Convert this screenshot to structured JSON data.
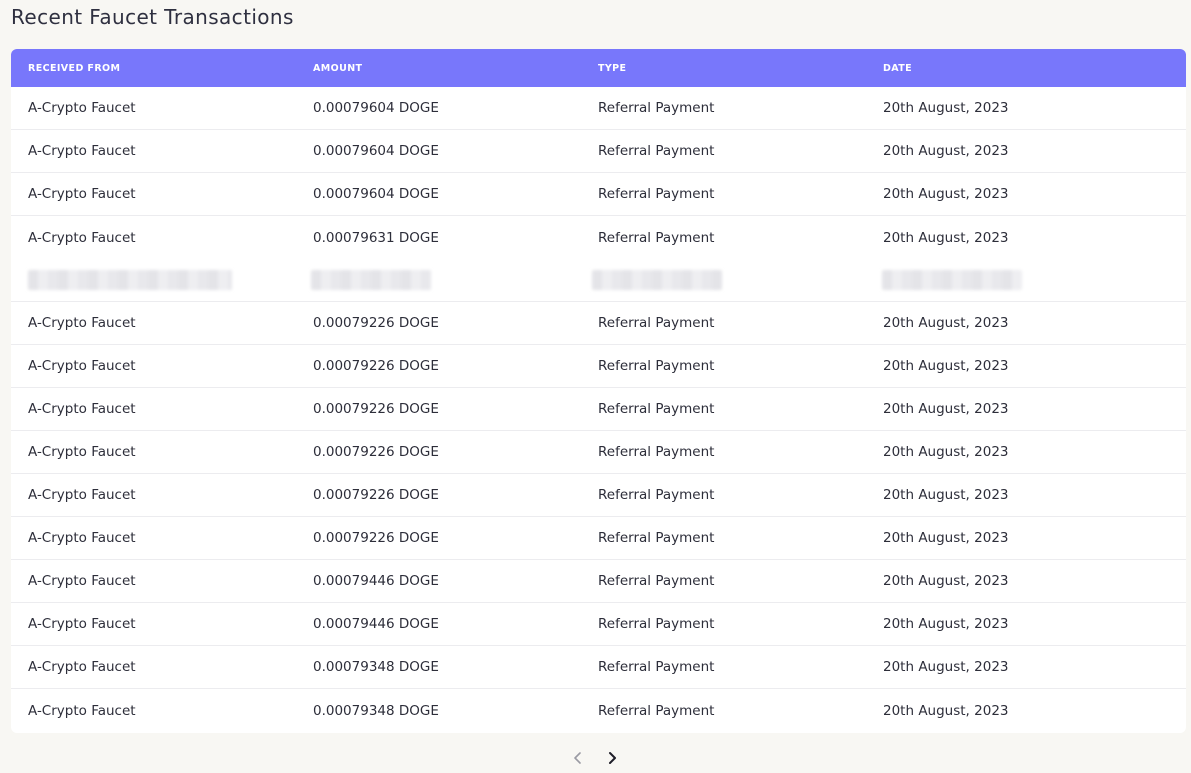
{
  "page": {
    "title": "Recent Faucet Transactions"
  },
  "table": {
    "columns": [
      "RECEIVED FROM",
      "AMOUNT",
      "TYPE",
      "DATE"
    ],
    "rows_top": [
      [
        "A-Crypto Faucet",
        "0.00079604 DOGE",
        "Referral Payment",
        "20th August, 2023"
      ],
      [
        "A-Crypto Faucet",
        "0.00079604 DOGE",
        "Referral Payment",
        "20th August, 2023"
      ],
      [
        "A-Crypto Faucet",
        "0.00079604 DOGE",
        "Referral Payment",
        "20th August, 2023"
      ],
      [
        "A-Crypto Faucet",
        "0.00079631 DOGE",
        "Referral Payment",
        "20th August, 2023"
      ]
    ],
    "rows_bottom": [
      [
        "A-Crypto Faucet",
        "0.00079226 DOGE",
        "Referral Payment",
        "20th August, 2023"
      ],
      [
        "A-Crypto Faucet",
        "0.00079226 DOGE",
        "Referral Payment",
        "20th August, 2023"
      ],
      [
        "A-Crypto Faucet",
        "0.00079226 DOGE",
        "Referral Payment",
        "20th August, 2023"
      ],
      [
        "A-Crypto Faucet",
        "0.00079226 DOGE",
        "Referral Payment",
        "20th August, 2023"
      ],
      [
        "A-Crypto Faucet",
        "0.00079226 DOGE",
        "Referral Payment",
        "20th August, 2023"
      ],
      [
        "A-Crypto Faucet",
        "0.00079226 DOGE",
        "Referral Payment",
        "20th August, 2023"
      ],
      [
        "A-Crypto Faucet",
        "0.00079446 DOGE",
        "Referral Payment",
        "20th August, 2023"
      ],
      [
        "A-Crypto Faucet",
        "0.00079446 DOGE",
        "Referral Payment",
        "20th August, 2023"
      ],
      [
        "A-Crypto Faucet",
        "0.00079348 DOGE",
        "Referral Payment",
        "20th August, 2023"
      ],
      [
        "A-Crypto Faucet",
        "0.00079348 DOGE",
        "Referral Payment",
        "20th August, 2023"
      ]
    ]
  },
  "pagination": {
    "prev_icon": "chevron-left-icon",
    "next_icon": "chevron-right-icon"
  },
  "colors": {
    "header_bg": "#7877fb",
    "page_bg": "#f8f7f3"
  }
}
